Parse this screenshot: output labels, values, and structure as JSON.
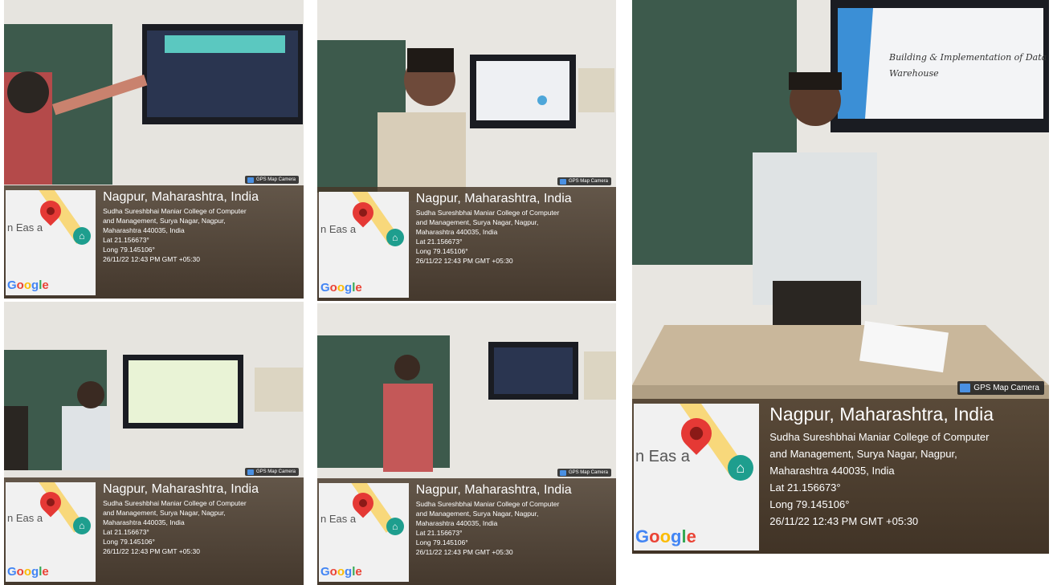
{
  "badge_label": "GPS Map Camera",
  "map": {
    "place_fragment": "n Eas",
    "place_fragment_tail": "a",
    "logo_text": "Google"
  },
  "location": {
    "city": "Nagpur, Maharashtra, India",
    "address_line1": "Sudha Sureshbhai Maniar College of Computer",
    "address_line2": "and Management, Surya Nagar, Nagpur,",
    "address_line3": "Maharashtra 440035, India",
    "lat": "Lat 21.156673°",
    "long": "Long 79.145106°",
    "timestamp": "26/11/22 12:43 PM GMT +05:30"
  },
  "slide_text": "Building & Implementation of Data Warehouse",
  "colors": {
    "overlay": "#4a3a2a",
    "pin": "#e53935",
    "poi": "#1e9e8e",
    "board": "#3d5a4c",
    "wall": "#e8e6e1"
  }
}
